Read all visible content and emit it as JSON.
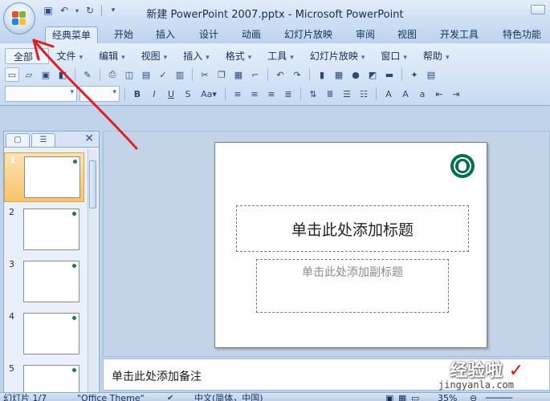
{
  "window": {
    "title": "新建 PowerPoint 2007.pptx - Microsoft PowerPoint"
  },
  "quick_access": [
    "save-icon",
    "undo-icon",
    "redo-icon",
    "customize-icon"
  ],
  "ribbon_tabs": [
    {
      "label": "经典菜单",
      "active": true
    },
    {
      "label": "开始"
    },
    {
      "label": "插入"
    },
    {
      "label": "设计"
    },
    {
      "label": "动画"
    },
    {
      "label": "幻灯片放映"
    },
    {
      "label": "审阅"
    },
    {
      "label": "视图"
    },
    {
      "label": "开发工具"
    },
    {
      "label": "特色功能"
    }
  ],
  "menus": [
    "全部",
    "文件",
    "编辑",
    "视图",
    "插入",
    "格式",
    "工具",
    "幻灯片放映",
    "窗口",
    "帮助"
  ],
  "thumbnails": [
    {
      "num": "1",
      "selected": true
    },
    {
      "num": "2"
    },
    {
      "num": "3"
    },
    {
      "num": "4"
    },
    {
      "num": "5"
    }
  ],
  "slide": {
    "title_placeholder": "单击此处添加标题",
    "subtitle_placeholder": "单击此处添加副标题",
    "logo": "starbucks-logo"
  },
  "notes": {
    "placeholder": "单击此处添加备注"
  },
  "status": {
    "slide_info": "幻灯片 1/7",
    "theme": "\"Office Theme\"",
    "language": "中文(简体，中国)",
    "zoom": "35%"
  },
  "watermark": {
    "text": "经验啦",
    "url": "jingyanla.com"
  },
  "colors": {
    "annotation_arrow": "#e02020",
    "selected_thumb": "#f7c36a"
  }
}
